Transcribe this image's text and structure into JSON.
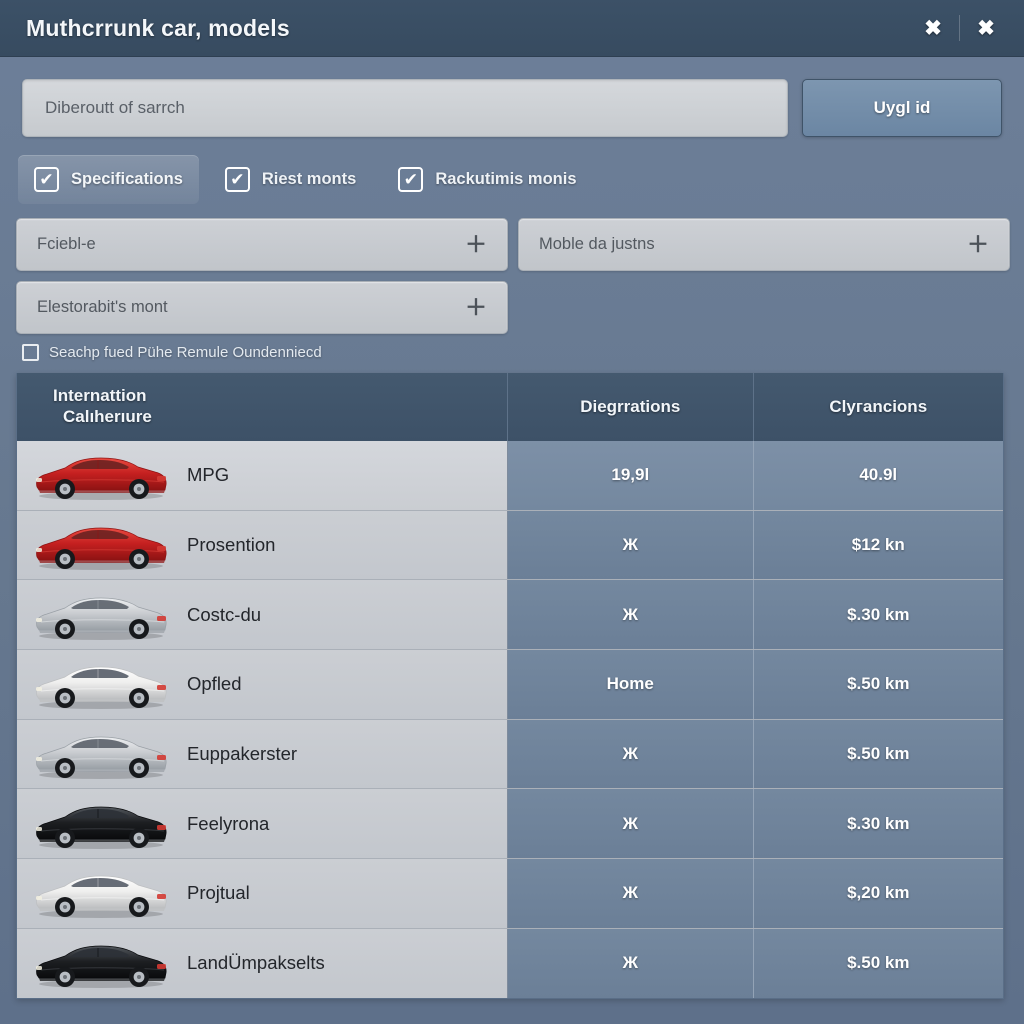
{
  "header": {
    "title": "Muthcrrunk car, models",
    "close_label": "✖",
    "close_secondary_label": "✖"
  },
  "search": {
    "placeholder": "Diberoutt of sarrch",
    "value": "",
    "apply_label": "Uygl id"
  },
  "filters": [
    {
      "label": "Specifications",
      "checked": true,
      "active": true,
      "check_glyph": "✔"
    },
    {
      "label": "Riest monts",
      "checked": true,
      "active": false,
      "check_glyph": "✔"
    },
    {
      "label": "Rackutimis monis",
      "checked": true,
      "active": false,
      "check_glyph": "✔"
    }
  ],
  "selects": [
    {
      "value": "Fciebl-e",
      "add_glyph": "＋"
    },
    {
      "value": "Moble da justns",
      "add_glyph": "＋"
    },
    {
      "value": "Elestorabit's mont",
      "add_glyph": "＋"
    }
  ],
  "sub_checkbox": {
    "label": "Seachp fued Pühe Remule Oundenniecd",
    "checked": false
  },
  "table": {
    "columns": {
      "model_line1": "Internattion",
      "model_line2": "Calıherıure",
      "col2": "Diegrrations",
      "col3": "Clугancions"
    },
    "rows": [
      {
        "name": "MPG",
        "car_color": "red",
        "col2": "19,9l",
        "col3": "40.9l",
        "highlight": true
      },
      {
        "name": "Prosention",
        "car_color": "red",
        "col2": "Ж",
        "col3": "$12 kn",
        "highlight": false
      },
      {
        "name": "Costc-du",
        "car_color": "silver",
        "col2": "Ж",
        "col3": "$.30 km",
        "highlight": false
      },
      {
        "name": "Opfled",
        "car_color": "white",
        "col2": "Home",
        "col3": "$.50 km",
        "highlight": false
      },
      {
        "name": "Euppakerster",
        "car_color": "silver",
        "col2": "Ж",
        "col3": "$.50 km",
        "highlight": false
      },
      {
        "name": "Feelyrona",
        "car_color": "black",
        "col2": "Ж",
        "col3": "$.30 km",
        "highlight": false
      },
      {
        "name": "Projtual",
        "car_color": "white",
        "col2": "Ж",
        "col3": "$,20 km",
        "highlight": false
      },
      {
        "name": "LandÜmpakselts",
        "car_color": "black",
        "col2": "Ж",
        "col3": "$.50 km",
        "highlight": false
      }
    ]
  },
  "colors": {
    "window_bg": "#6e809a",
    "titlebar": "#3c5167",
    "accent_button": "#7d96b0",
    "table_header": "#44596f",
    "value_cell": "#74889f",
    "model_cell": "#cbced3",
    "input_bg": "#cdd0d5"
  }
}
